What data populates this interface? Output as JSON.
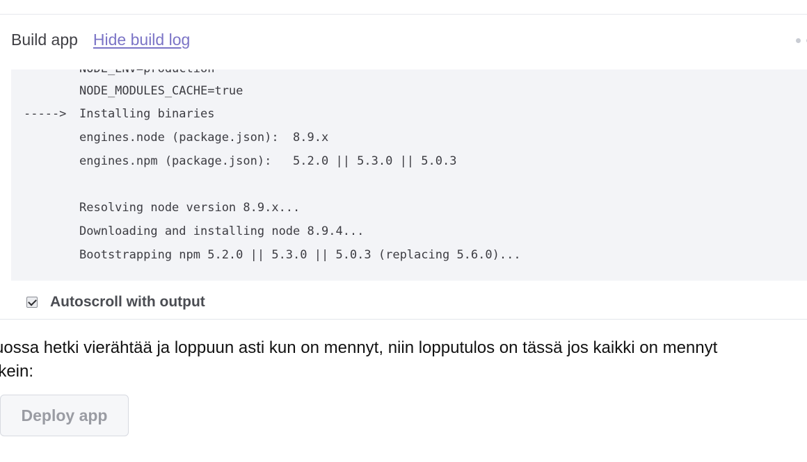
{
  "build": {
    "title": "Build app",
    "hide_log_link": "Hide build log"
  },
  "log": {
    "arrow": "----->",
    "lines": [
      "NODE_ENV=production",
      "NODE_MODULES_CACHE=true",
      "Installing binaries",
      "engines.node (package.json):  8.9.x",
      "engines.npm (package.json):   5.2.0 || 5.3.0 || 5.0.3",
      "",
      "Resolving node version 8.9.x...",
      "Downloading and installing node 8.9.4...",
      "Bootstrapping npm 5.2.0 || 5.3.0 || 5.0.3 (replacing 5.6.0)..."
    ]
  },
  "autoscroll": {
    "label": "Autoscroll with output",
    "checked": true
  },
  "body_text": "uossa hetki vierähtää ja loppuun asti kun on mennyt, niin lopputulos on tässä jos kaikki on mennyt\nikein:",
  "deploy": {
    "label": "Deploy app"
  },
  "icons": {
    "status": "status-dots-icon",
    "checkbox": "checkmark-icon"
  }
}
